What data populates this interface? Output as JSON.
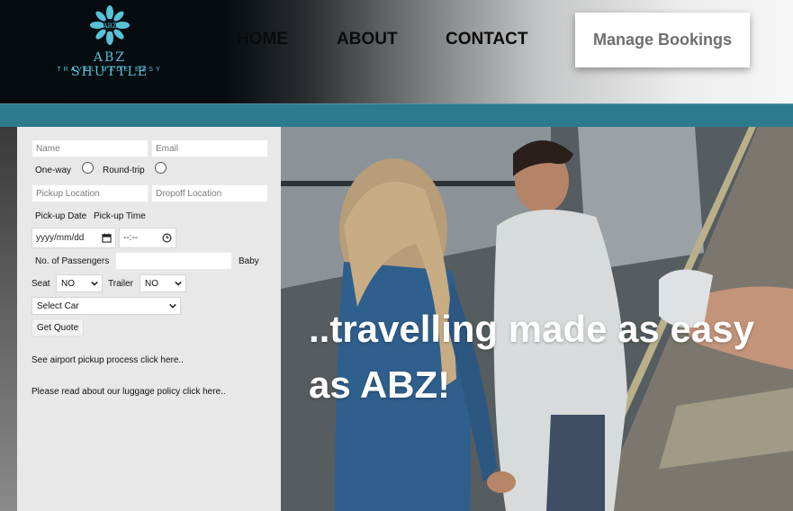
{
  "header": {
    "logo": {
      "monogram": "ABZ",
      "title": "ABZ SHUTTLE",
      "tagline": "TRAVEL MADE EASY"
    },
    "nav": [
      "HOME",
      "ABOUT",
      "CONTACT"
    ],
    "manage_bookings": "Manage Bookings"
  },
  "form": {
    "name_placeholder": "Name",
    "email_placeholder": "Email",
    "trip_type": {
      "one_way": "One-way",
      "round_trip": "Round-trip"
    },
    "pickup_location_placeholder": "Pickup Location",
    "dropoff_location_placeholder": "Dropoff Location",
    "pickup_date_label": "Pick-up Date",
    "pickup_time_label": "Pick-up Time",
    "date_value": "yyyy/mm/dd",
    "time_value": "--:--",
    "passengers_label": "No. of Passengers",
    "baby_seat_label_1": "Baby",
    "baby_seat_label_2": "Seat",
    "baby_seat_value": "NO",
    "trailer_label": "Trailer",
    "trailer_value": "NO",
    "car_select_value": "Select Car",
    "get_quote": "Get Quote",
    "airport_link": "See airport pickup process click here..",
    "luggage_link": "Please read about our luggage policy click here.."
  },
  "hero": {
    "line1": "..travelling made as easy",
    "line2": "as ABZ!"
  },
  "colors": {
    "logo_teal": "#57c3d8",
    "strip": "#2c7a8e",
    "panel_bg": "#e8e8e8"
  }
}
